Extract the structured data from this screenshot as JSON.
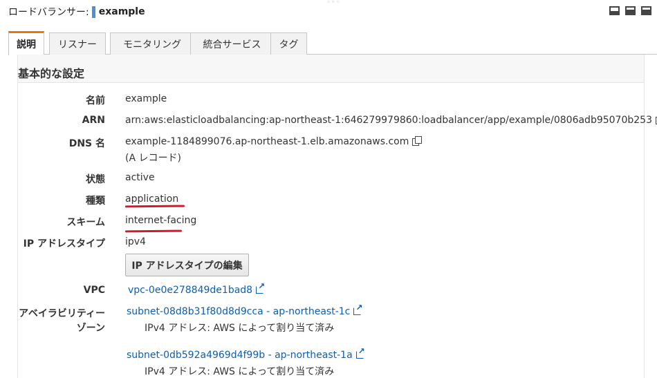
{
  "header": {
    "title_label": "ロードバランサー:",
    "title_name": "example",
    "window_icons": [
      "bottom-panel-icon",
      "split-panel-icon",
      "full-panel-icon"
    ]
  },
  "tabs": [
    {
      "label": "説明",
      "active": true
    },
    {
      "label": "リスナー",
      "active": false
    },
    {
      "label": "モニタリング",
      "active": false
    },
    {
      "label": "統合サービス",
      "active": false
    },
    {
      "label": "タグ",
      "active": false
    }
  ],
  "section": {
    "title": "基本的な設定"
  },
  "fields": {
    "name": {
      "label": "名前",
      "value": "example"
    },
    "arn": {
      "label": "ARN",
      "value": "arn:aws:elasticloadbalancing:ap-northeast-1:646279979860:loadbalancer/app/example/0806adb95070b253"
    },
    "dns": {
      "label": "DNS 名",
      "value": "example-1184899076.ap-northeast-1.elb.amazonaws.com",
      "note": "(A レコード)"
    },
    "state": {
      "label": "状態",
      "value": "active"
    },
    "type": {
      "label": "種類",
      "value": "application"
    },
    "scheme": {
      "label": "スキーム",
      "value": "internet-facing"
    },
    "ip_type": {
      "label": "IP アドレスタイプ",
      "value": "ipv4",
      "edit_button": "IP アドレスタイプの編集"
    },
    "vpc": {
      "label": "VPC",
      "value": "vpc-0e0e278849de1bad8"
    },
    "az": {
      "label_line1": "アベイラビリティー",
      "label_line2": "ゾーン",
      "subnets": [
        {
          "link": "subnet-08d8b31f80d8d9cca - ap-northeast-1c",
          "note": "IPv4 アドレス: AWS によって割り当て済み"
        },
        {
          "link": "subnet-0db592a4969d4f99b - ap-northeast-1a",
          "note": "IPv4 アドレス: AWS によって割り当て済み"
        }
      ]
    }
  },
  "colors": {
    "link": "#0a5fb4",
    "active_tab_accent": "#ec7211",
    "annotation_underline": "#d6182a"
  }
}
